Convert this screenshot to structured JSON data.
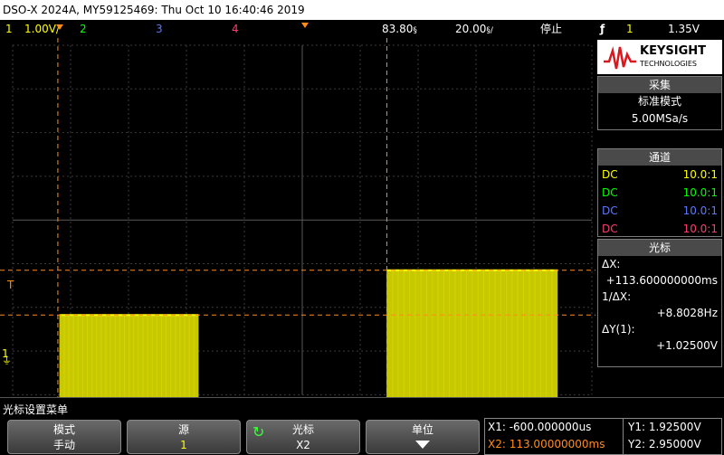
{
  "title": "DSO-X 2024A, MY59125469: Thu Oct 10 16:40:46 2019",
  "status": {
    "ch1_num": "1",
    "ch1_scale": "1.00V/",
    "ch2_num": "2",
    "ch3_num": "3",
    "ch4_num": "4",
    "time_delay": "83.80",
    "time_scale": "20.00",
    "run_state": "停止",
    "trig_source": "1",
    "trig_level": "1.35V"
  },
  "colors": {
    "ch1": "#ffff00",
    "ch2": "#00ff00",
    "ch3": "#5a78ff",
    "ch4": "#ff3c6e",
    "cursor": "#ff8c1a",
    "accent": "#1a9f52"
  },
  "brand": {
    "name": "KEYSIGHT",
    "sub": "TECHNOLOGIES"
  },
  "acquire": {
    "header": "采集",
    "mode": "标准模式",
    "rate": "5.00MSa/s"
  },
  "channels": {
    "header": "通道",
    "rows": [
      {
        "coupling": "DC",
        "probe": "10.0:1"
      },
      {
        "coupling": "DC",
        "probe": "10.0:1"
      },
      {
        "coupling": "DC",
        "probe": "10.0:1"
      },
      {
        "coupling": "DC",
        "probe": "10.0:1"
      }
    ]
  },
  "cursors_panel": {
    "header": "光标",
    "dx_label": "ΔX:",
    "dx_value": "+113.600000000ms",
    "inv_dx_label": "1/ΔX:",
    "inv_dx_value": "+8.8028Hz",
    "dy_label": "ΔY(1):",
    "dy_value": "+1.02500V"
  },
  "menu": {
    "title": "光标设置菜单",
    "mode_label": "模式",
    "mode_value": "手动",
    "source_label": "源",
    "source_value": "1",
    "cursors_label": "光标",
    "cursors_value": "X2",
    "units_label": "单位"
  },
  "readout": {
    "x1": "X1: -600.000000us",
    "x2": "X2: 113.00000000ms",
    "y1": "Y1: 1.92500V",
    "y2": "Y2: 2.95000V"
  },
  "markers": {
    "trigger": "T",
    "ch1": "1"
  },
  "waveform": {
    "time_per_div_ms": 20,
    "delay_ms": 83.8,
    "volts_per_div": 1.0,
    "baseline_v": 0.0,
    "pulses": [
      {
        "start_ms": 0.0,
        "end_ms": 48.0,
        "level_v": 1.925
      },
      {
        "start_ms": 113.0,
        "end_ms": 172.0,
        "level_v": 2.95
      }
    ],
    "cursors": {
      "x1_ms": -0.6,
      "x2_ms": 113.0,
      "y1_v": 1.925,
      "y2_v": 2.95
    }
  }
}
